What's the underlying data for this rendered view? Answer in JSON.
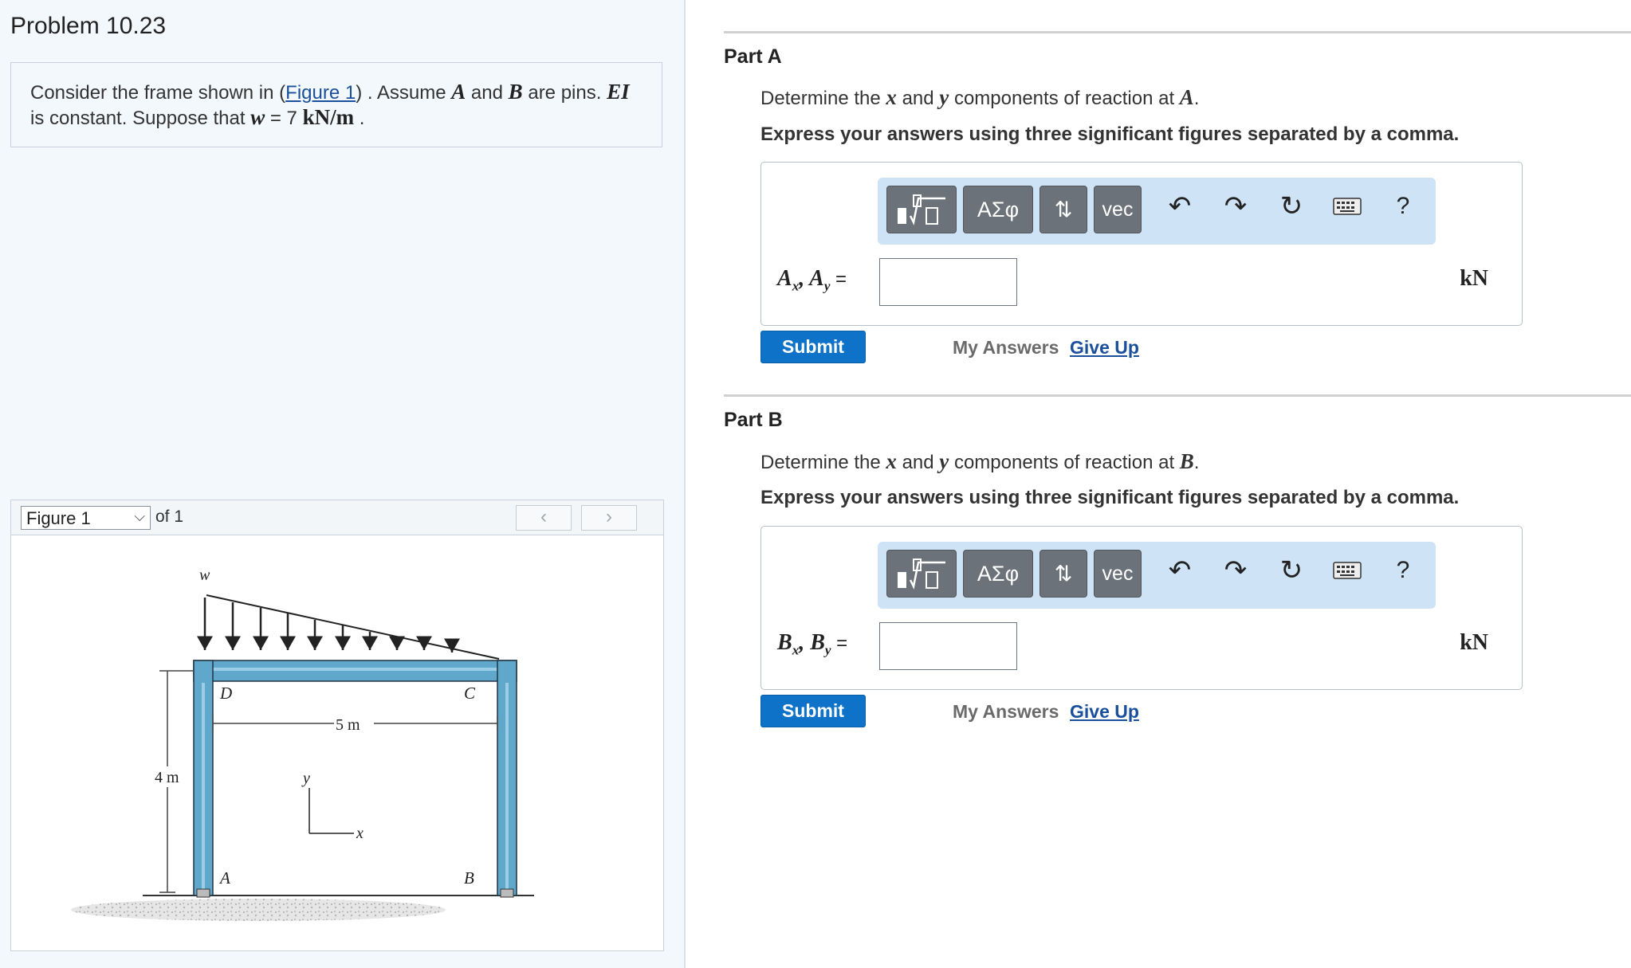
{
  "problem": {
    "title": "Problem 10.23",
    "text_1": "Consider the frame shown in (",
    "figure_link": "Figure 1",
    "text_2": ") . Assume ",
    "var_a": "A",
    "text_3": " and ",
    "var_b": "B",
    "text_4": " are pins. ",
    "var_ei": "EI",
    "text_5": "is constant. Suppose that ",
    "var_w": "w",
    "text_6": " = 7 ",
    "unit": "kN/m",
    "text_7": " ."
  },
  "figure": {
    "selector_value": "Figure 1",
    "of_text": "of 1",
    "prev_icon": "chevron-left-icon",
    "next_icon": "chevron-right-icon",
    "labels": {
      "load": "w",
      "d": "D",
      "c": "C",
      "a": "A",
      "b": "B",
      "span": "5 m",
      "height": "4 m",
      "y_axis": "y",
      "x_axis": "x"
    }
  },
  "toolbar": {
    "templates_icon": "fraction-sqrt-templates-icon",
    "greek": "ΑΣφ",
    "arrows": "⇅",
    "vec": "vec",
    "undo_icon": "undo-icon",
    "redo_icon": "redo-icon",
    "reset_icon": "reset-icon",
    "keyboard_icon": "keyboard-icon",
    "help": "?"
  },
  "part_a": {
    "title": "Part A",
    "q_1": "Determine the ",
    "q_x": "x",
    "q_2": " and ",
    "q_y": "y",
    "q_3": " components of reaction at ",
    "q_pt": "A",
    "q_4": ".",
    "instruction": "Express your answers using three significant figures separated by a comma.",
    "label_1": "A",
    "sub_1": "x",
    "label_sep": ", ",
    "label_2": "A",
    "sub_2": "y",
    "label_eq": " =",
    "input_value": "",
    "unit": "kN",
    "submit": "Submit",
    "my_answers": "My Answers",
    "give_up": "Give Up"
  },
  "part_b": {
    "title": "Part B",
    "q_1": "Determine the ",
    "q_x": "x",
    "q_2": " and ",
    "q_y": "y",
    "q_3": " components of reaction at ",
    "q_pt": "B",
    "q_4": ".",
    "instruction": "Express your answers using three significant figures separated by a comma.",
    "label_1": "B",
    "sub_1": "x",
    "label_sep": ", ",
    "label_2": "B",
    "sub_2": "y",
    "label_eq": " =",
    "input_value": "",
    "unit": "kN",
    "submit": "Submit",
    "my_answers": "My Answers",
    "give_up": "Give Up"
  },
  "colors": {
    "left_panel_bg": "#f3f8fd",
    "toolbar_bg": "#cfe3f7",
    "toolbar_button": "#6b7279",
    "submit_bg": "#0e73c8",
    "link": "#1a4f9c",
    "frame_member": "#5fa8cc"
  }
}
